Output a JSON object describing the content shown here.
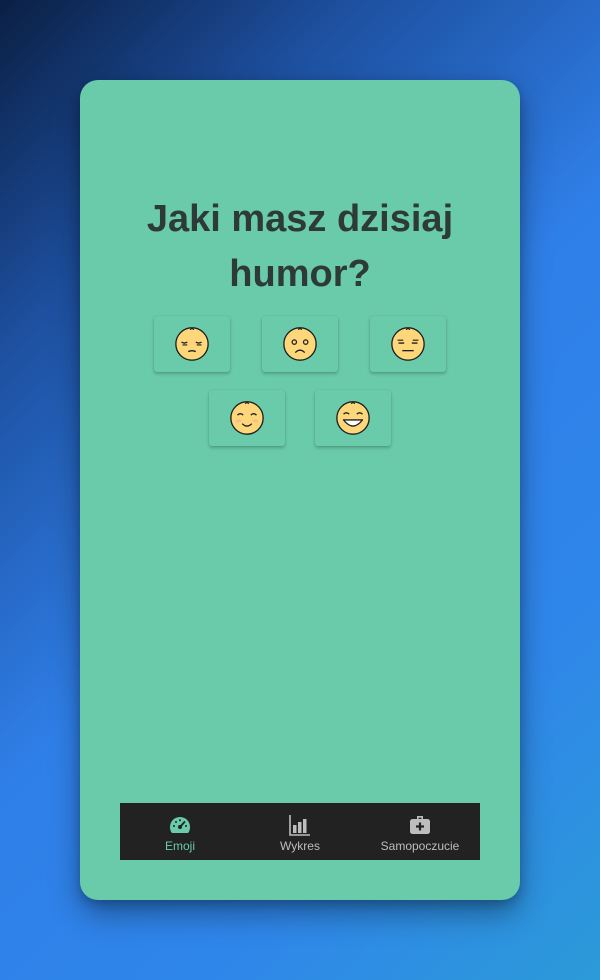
{
  "page": {
    "title": "Jaki masz dzisiaj humor?"
  },
  "moods": [
    {
      "name": "pensive-face",
      "icon": "pensive-face-icon"
    },
    {
      "name": "frowning-face",
      "icon": "frowning-face-icon"
    },
    {
      "name": "expressionless-face",
      "icon": "expressionless-face-icon"
    },
    {
      "name": "smiling-face",
      "icon": "smiling-face-icon"
    },
    {
      "name": "grinning-face",
      "icon": "grinning-face-icon"
    }
  ],
  "nav": {
    "items": [
      {
        "label": "Emoji",
        "icon": "speedometer-icon",
        "active": true
      },
      {
        "label": "Wykres",
        "icon": "bar-chart-icon",
        "active": false
      },
      {
        "label": "Samopoczucie",
        "icon": "medical-bag-icon",
        "active": false
      }
    ]
  },
  "colors": {
    "card": "#69cba9",
    "navbar": "#222222",
    "active": "#69cba9",
    "inactive": "#bdbdbd",
    "title": "#2e3a37",
    "emoji_fill": "#fdd77a"
  }
}
